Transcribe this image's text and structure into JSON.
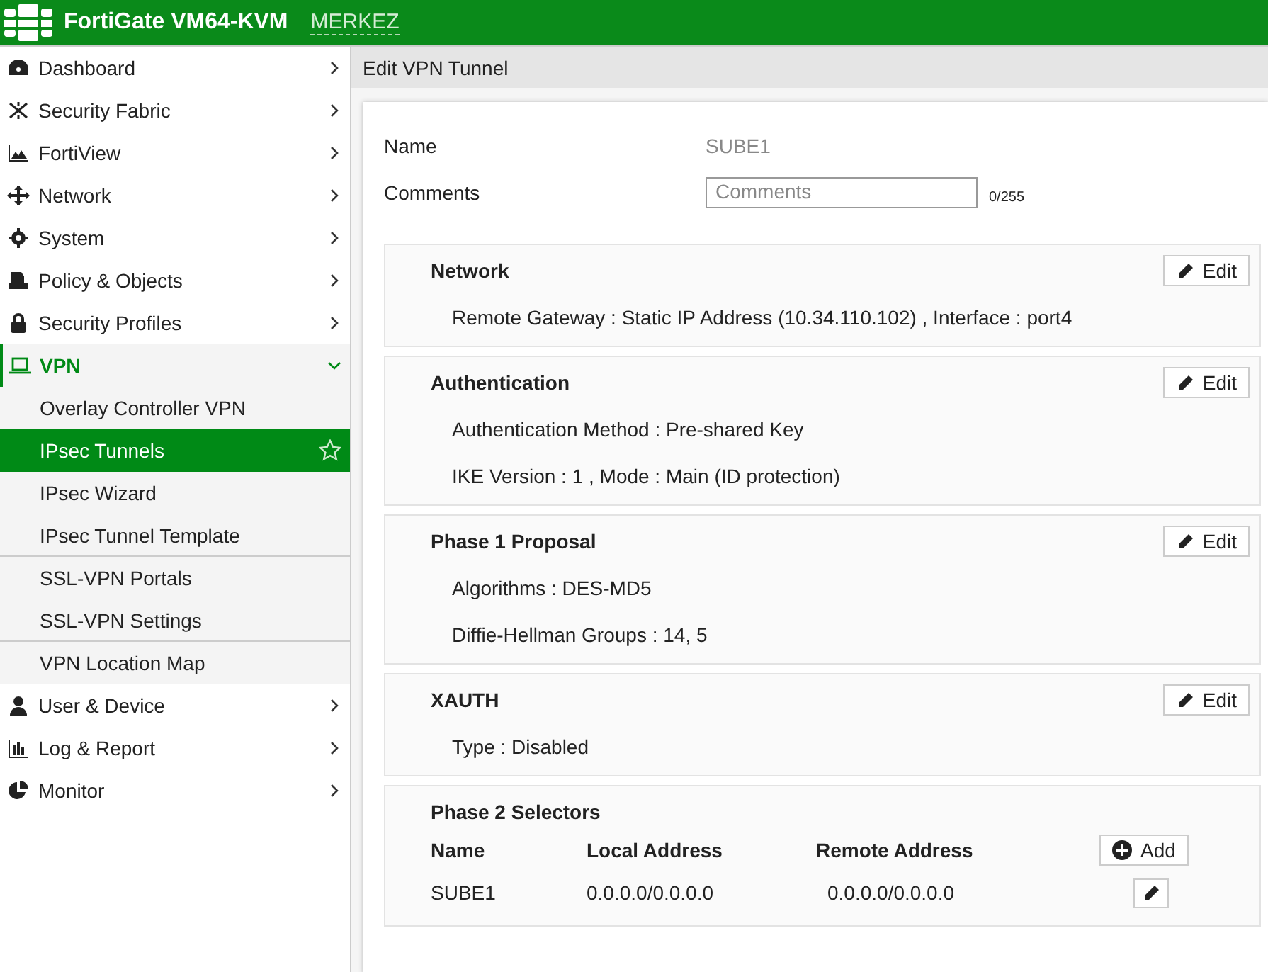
{
  "header": {
    "product": "FortiGate VM64-KVM",
    "hostname": "MERKEZ"
  },
  "sidebar": {
    "items": [
      {
        "label": "Dashboard",
        "expanded": false
      },
      {
        "label": "Security Fabric",
        "expanded": false
      },
      {
        "label": "FortiView",
        "expanded": false
      },
      {
        "label": "Network",
        "expanded": false
      },
      {
        "label": "System",
        "expanded": false
      },
      {
        "label": "Policy & Objects",
        "expanded": false
      },
      {
        "label": "Security Profiles",
        "expanded": false
      },
      {
        "label": "VPN",
        "expanded": true,
        "children": [
          {
            "label": "Overlay Controller VPN",
            "selected": false,
            "group_end": false
          },
          {
            "label": "IPsec Tunnels",
            "selected": true,
            "group_end": false
          },
          {
            "label": "IPsec Wizard",
            "selected": false,
            "group_end": false
          },
          {
            "label": "IPsec Tunnel Template",
            "selected": false,
            "group_end": true
          },
          {
            "label": "SSL-VPN Portals",
            "selected": false,
            "group_end": false
          },
          {
            "label": "SSL-VPN Settings",
            "selected": false,
            "group_end": true
          },
          {
            "label": "VPN Location Map",
            "selected": false,
            "group_end": false
          }
        ]
      },
      {
        "label": "User & Device",
        "expanded": false
      },
      {
        "label": "Log & Report",
        "expanded": false
      },
      {
        "label": "Monitor",
        "expanded": false
      }
    ]
  },
  "breadcrumb": "Edit VPN Tunnel",
  "form": {
    "name_label": "Name",
    "name_value": "SUBE1",
    "comments_label": "Comments",
    "comments_placeholder": "Comments",
    "comments_count": "0/255"
  },
  "sections": [
    {
      "title": "Network",
      "button": "Edit",
      "lines": [
        "Remote Gateway : Static IP Address (10.34.110.102) , Interface : port4"
      ]
    },
    {
      "title": "Authentication",
      "button": "Edit",
      "lines": [
        "Authentication Method : Pre-shared Key",
        "IKE Version : 1 , Mode : Main (ID protection)"
      ]
    },
    {
      "title": "Phase 1 Proposal",
      "button": "Edit",
      "lines": [
        "Algorithms : DES-MD5",
        "Diffie-Hellman Groups : 14, 5"
      ]
    },
    {
      "title": "XAUTH",
      "button": "Edit",
      "lines": [
        "Type : Disabled"
      ]
    }
  ],
  "phase2": {
    "title": "Phase 2 Selectors",
    "columns": [
      "Name",
      "Local Address",
      "Remote Address"
    ],
    "add_button": "Add",
    "rows": [
      [
        "SUBE1",
        "0.0.0.0/0.0.0.0",
        "0.0.0.0/0.0.0.0"
      ]
    ]
  }
}
